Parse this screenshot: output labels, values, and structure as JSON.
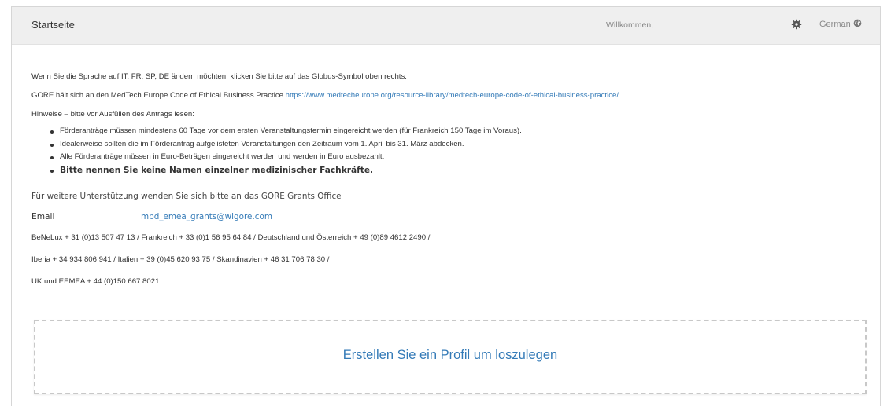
{
  "header": {
    "title": "Startseite",
    "welcome": "Willkommen,",
    "settings_icon": "gear-icon",
    "language_label": "German",
    "language_icon": "globe-icon"
  },
  "intro": {
    "language_hint": "Wenn Sie die Sprache auf IT, FR, SP, DE ändern möchten, klicken Sie bitte auf das Globus-Symbol oben rechts.",
    "code_text": "GORE hält sich an den MedTech Europe Code of Ethical Business Practice ",
    "code_link": "https://www.medtecheurope.org/resource-library/medtech-europe-code-of-ethical-business-practice/",
    "notes_heading": "Hinweise – bitte vor Ausfüllen des Antrags lesen:"
  },
  "notes": [
    "Förderanträge müssen mindestens 60 Tage vor dem ersten Veranstaltungstermin eingereicht werden (für Frankreich 150 Tage im Voraus).",
    "Idealerweise sollten die im Förderantrag aufgelisteten Veranstaltungen den Zeitraum vom 1. April bis 31. März abdecken.",
    "Alle Förderanträge müssen in Euro-Beträgen eingereicht werden und werden in Euro ausbezahlt.",
    "Bitte nennen Sie keine Namen einzelner medizinischer Fachkräfte."
  ],
  "contact": {
    "support_text": "Für weitere Unterstützung wenden Sie sich bitte an das GORE Grants Office",
    "email_label": "Email",
    "email_value": "mpd_emea_grants@wlgore.com",
    "phones_line1": "BeNeLux + 31 (0)13 507 47 13 / Frankreich + 33 (0)1 56 95 64 84 / Deutschland und Österreich + 49 (0)89 4612 2490 /",
    "phones_line2": "Iberia + 34 934 806 941 / Italien + 39 (0)45 620 93 75 / Skandinavien + 46 31 706 78 30 /",
    "phones_line3": "UK und EEMEA + 44 (0)150 667 8021"
  },
  "cta": {
    "label": "Erstellen Sie ein Profil um loszulegen"
  },
  "colors": {
    "link": "#337ab7",
    "header_bg": "#efefef",
    "text": "#333333",
    "muted": "#8a8a8a"
  }
}
